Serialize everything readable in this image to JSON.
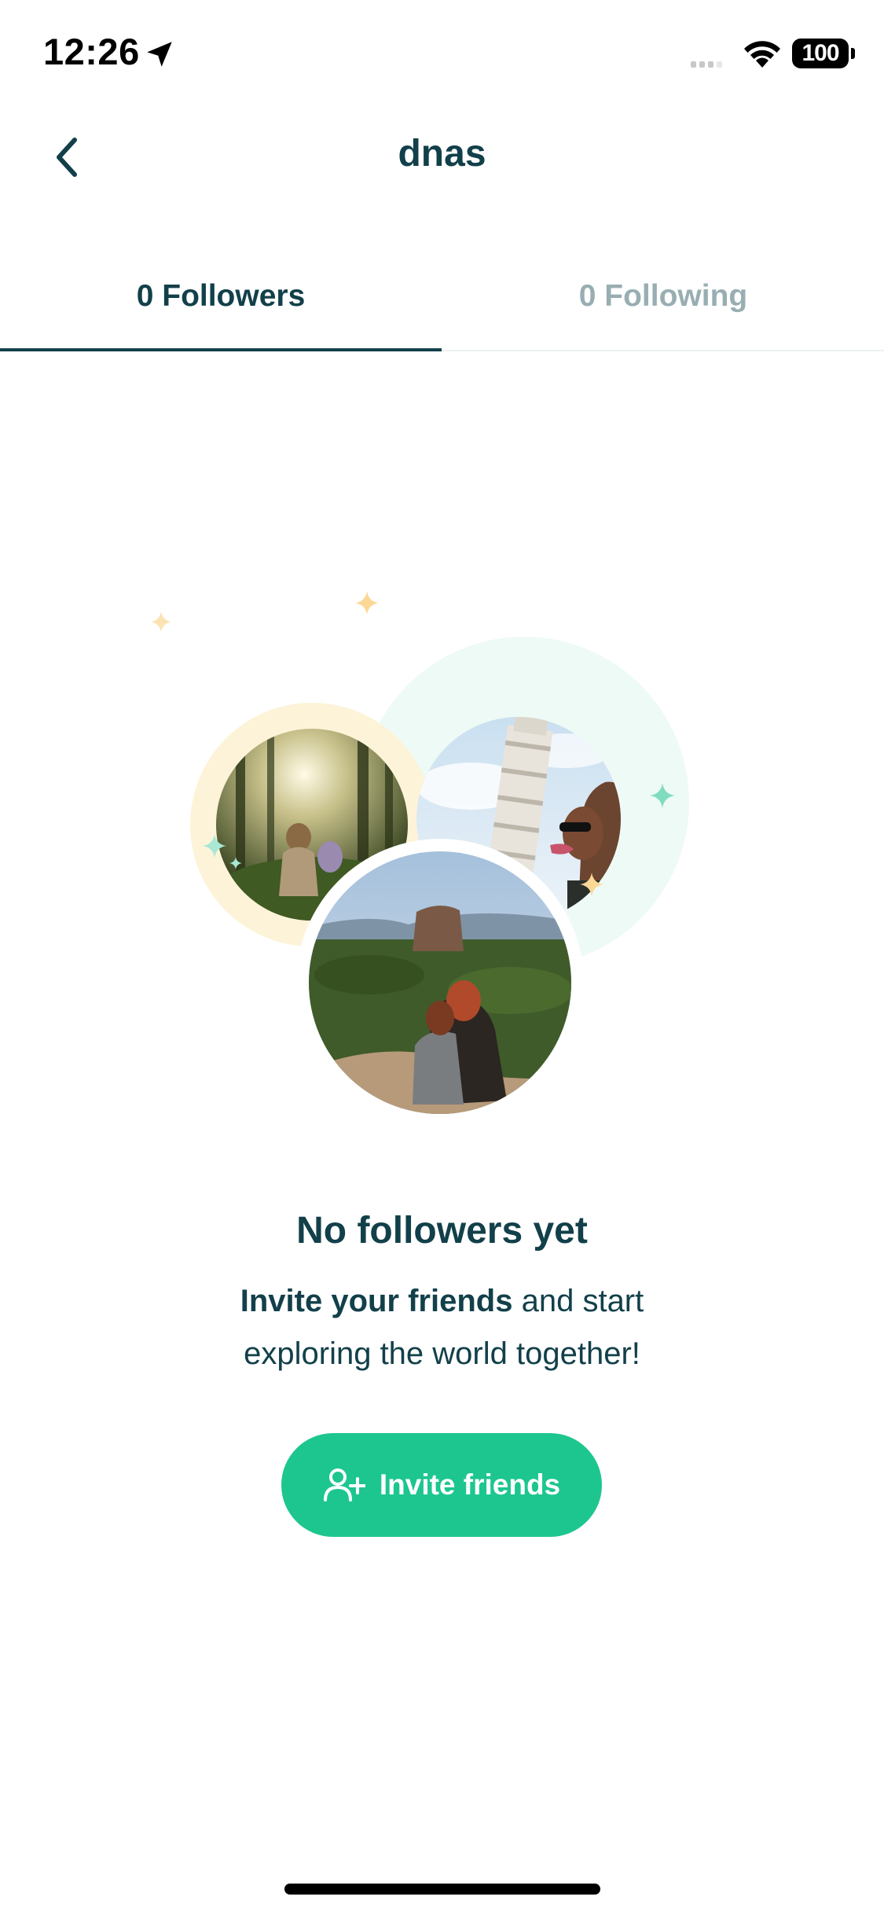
{
  "status_bar": {
    "time": "12:26",
    "battery": "100",
    "icons": [
      "location-arrow-icon",
      "cellular-signal-icon",
      "wifi-icon",
      "battery-icon"
    ]
  },
  "header": {
    "title": "dnas",
    "back_icon": "chevron-left-icon"
  },
  "tabs": [
    {
      "label": "0 Followers",
      "active": true
    },
    {
      "label": "0 Following",
      "active": false
    }
  ],
  "empty_state": {
    "title": "No followers yet",
    "description_bold": "Invite your friends",
    "description_rest": " and start exploring the world together!",
    "illustration_icon": "travel-photos-illustration"
  },
  "invite_button": {
    "label": "Invite friends",
    "icon": "add-user-icon"
  },
  "colors": {
    "primary_text": "#12404a",
    "inactive_tab": "#98aeb2",
    "accent_green": "#1dc68f",
    "mint_circle": "#eefaf5",
    "cream_circle": "#fdf3d8",
    "sparkle_yellow": "#fbd896",
    "sparkle_green": "#7fdcc0"
  }
}
